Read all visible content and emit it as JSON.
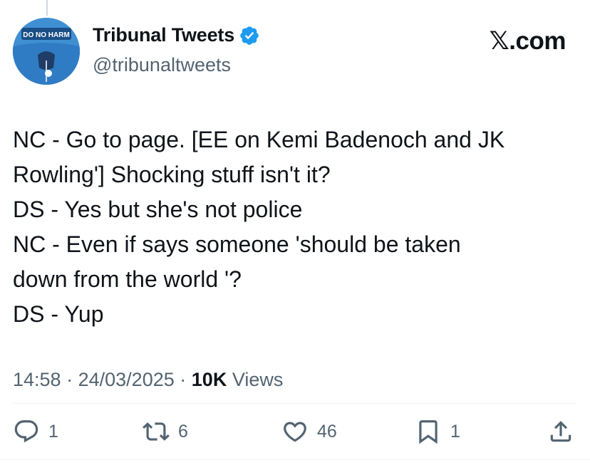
{
  "author": {
    "display_name": "Tribunal Tweets",
    "handle": "@tribunaltweets",
    "avatar_text": "DO NO HARM",
    "verified": true
  },
  "brand": "𝕏.com",
  "tweet": {
    "lines": [
      "NC - Go to page. [EE on Kemi Badenoch and JK",
      "Rowling'] Shocking stuff isn't it?",
      "DS - Yes but she's not police",
      "NC - Even if says someone 'should be taken",
      "down from the world '?",
      "DS - Yup"
    ]
  },
  "meta": {
    "time": "14:58",
    "separator": "·",
    "date": "24/03/2025",
    "views_count": "10K",
    "views_label": "Views"
  },
  "actions": {
    "replies": "1",
    "reposts": "6",
    "likes": "46",
    "bookmarks": "1"
  },
  "icons": [
    "reply-icon",
    "repost-icon",
    "like-icon",
    "bookmark-icon",
    "share-icon",
    "verified-badge-icon"
  ],
  "colors": {
    "text": "#0f1419",
    "secondary": "#536471",
    "verified": "#1d9bf0",
    "avatar_bg": "#3f8fd3"
  }
}
